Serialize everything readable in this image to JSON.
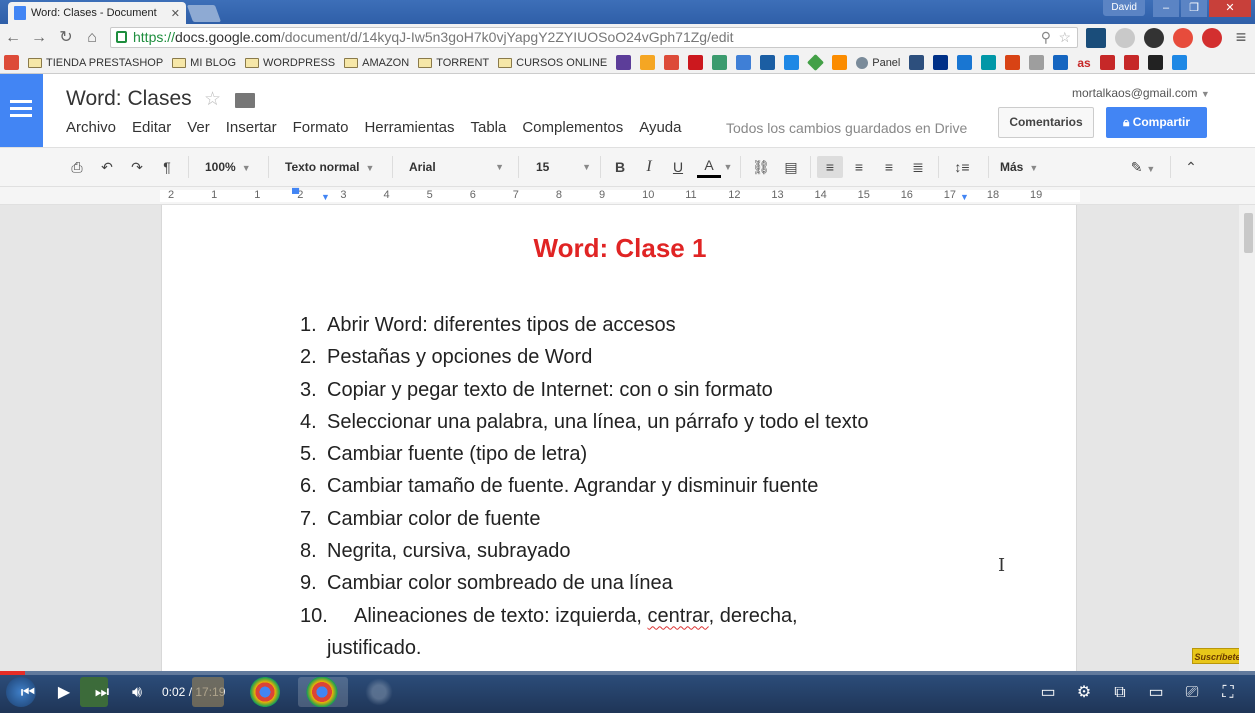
{
  "browser": {
    "tab_title": "Word: Clases - Document",
    "user_label": "David",
    "url_https": "https://",
    "url_host": "docs.google.com",
    "url_path": "/document/d/14kyqJ-Iw5n3goH7k0vjYapgY2ZYIUOSoO24vGph71Zg/edit",
    "bookmarks": [
      "TIENDA PRESTASHOP",
      "MI BLOG",
      "WORDPRESS",
      "AMAZON",
      "TORRENT",
      "CURSOS ONLINE"
    ],
    "bookmark_extra_label": "Panel",
    "bookmark_as_label": "as"
  },
  "docs": {
    "title": "Word: Clases",
    "account": "mortalkaos@gmail.com",
    "menu": [
      "Archivo",
      "Editar",
      "Ver",
      "Insertar",
      "Formato",
      "Herramientas",
      "Tabla",
      "Complementos",
      "Ayuda"
    ],
    "save_status": "Todos los cambios guardados en Drive",
    "comments_label": "Comentarios",
    "share_label": "Compartir"
  },
  "toolbar": {
    "zoom": "100%",
    "style": "Texto normal",
    "font": "Arial",
    "size": "15",
    "bold": "B",
    "italic": "I",
    "underline": "U",
    "text_color": "A",
    "more": "Más"
  },
  "ruler": {
    "labels": [
      "2",
      "1",
      "1",
      "2",
      "3",
      "4",
      "5",
      "6",
      "7",
      "8",
      "9",
      "10",
      "11",
      "12",
      "13",
      "14",
      "15",
      "16",
      "17",
      "18",
      "19"
    ]
  },
  "document": {
    "heading": "Word: Clase 1",
    "items": [
      {
        "num": "1.",
        "text": "Abrir Word: diferentes tipos de accesos"
      },
      {
        "num": "2.",
        "text": "Pestañas y opciones de Word"
      },
      {
        "num": "3.",
        "text": "Copiar y pegar texto de Internet: con o sin formato"
      },
      {
        "num": "4.",
        "text": "Seleccionar una palabra, una línea, un párrafo y todo el texto"
      },
      {
        "num": "5.",
        "text": "Cambiar fuente (tipo de letra)"
      },
      {
        "num": "6.",
        "text": "Cambiar tamaño de fuente. Agrandar y disminuir fuente"
      },
      {
        "num": "7.",
        "text": "Cambiar color de fuente"
      },
      {
        "num": "8.",
        "text": "Negrita, cursiva, subrayado"
      },
      {
        "num": "9.",
        "text": "Cambiar color sombreado de una línea"
      }
    ],
    "item10_num": "10.",
    "item10_pre": "Alineaciones de texto: izquierda, ",
    "item10_spell": "centrar",
    "item10_post": ", derecha,",
    "item10_cont": "justificado.",
    "heading_color": "#e02424"
  },
  "video": {
    "time": "0:02 / 17:19",
    "progress": 0.02,
    "subscribe": "Suscríbete!"
  },
  "colors": {
    "docs_blue": "#4285f4",
    "player_bg": "#2d4f7d",
    "progress_red": "#e52d27"
  }
}
